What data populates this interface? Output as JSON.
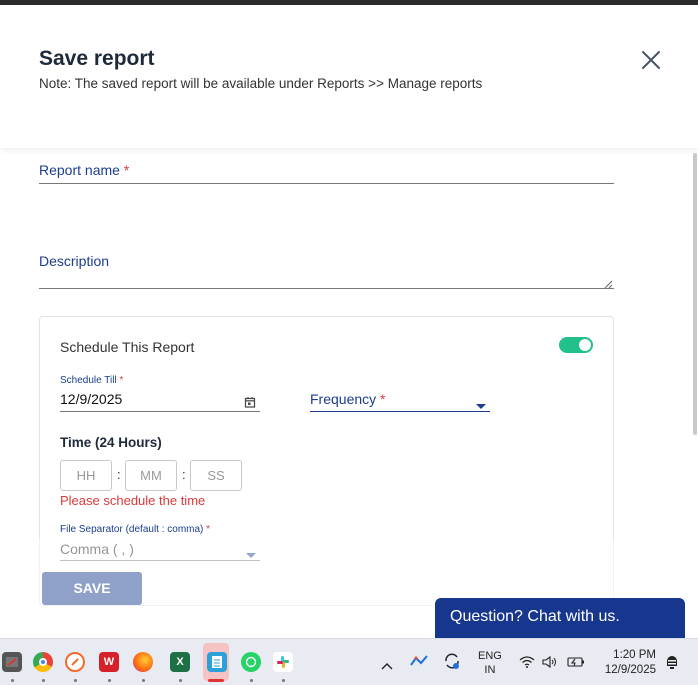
{
  "dialog": {
    "title": "Save report",
    "note": "Note: The saved report will be available under Reports >> Manage reports",
    "close_icon": "close-icon"
  },
  "form": {
    "report_name_label": "Report name",
    "report_name_required": "*",
    "report_name_value": "",
    "description_label": "Description",
    "description_value": ""
  },
  "schedule": {
    "title": "Schedule This Report",
    "enabled": true,
    "toggle_color": "#22c08a",
    "schedule_till_label": "Schedule Till",
    "schedule_till_required": "*",
    "schedule_till_value": "12/9/2025",
    "frequency_label": "Frequency",
    "frequency_required": "*",
    "time_title": "Time (24 Hours)",
    "hh_placeholder": "HH",
    "mm_placeholder": "MM",
    "ss_placeholder": "SS",
    "separator": ":",
    "error": "Please schedule the time",
    "error_color": "#d93a3a",
    "file_separator_label": "File Separator (default : comma)",
    "file_separator_required": "*",
    "file_separator_value": "Comma ( , )"
  },
  "actions": {
    "save_label": "SAVE"
  },
  "chat": {
    "label": "Question? Chat with us.",
    "color": "#17378f"
  },
  "taskbar": {
    "lang_line1": "ENG",
    "lang_line2": "IN",
    "time": "1:20 PM",
    "date": "12/9/2025"
  }
}
